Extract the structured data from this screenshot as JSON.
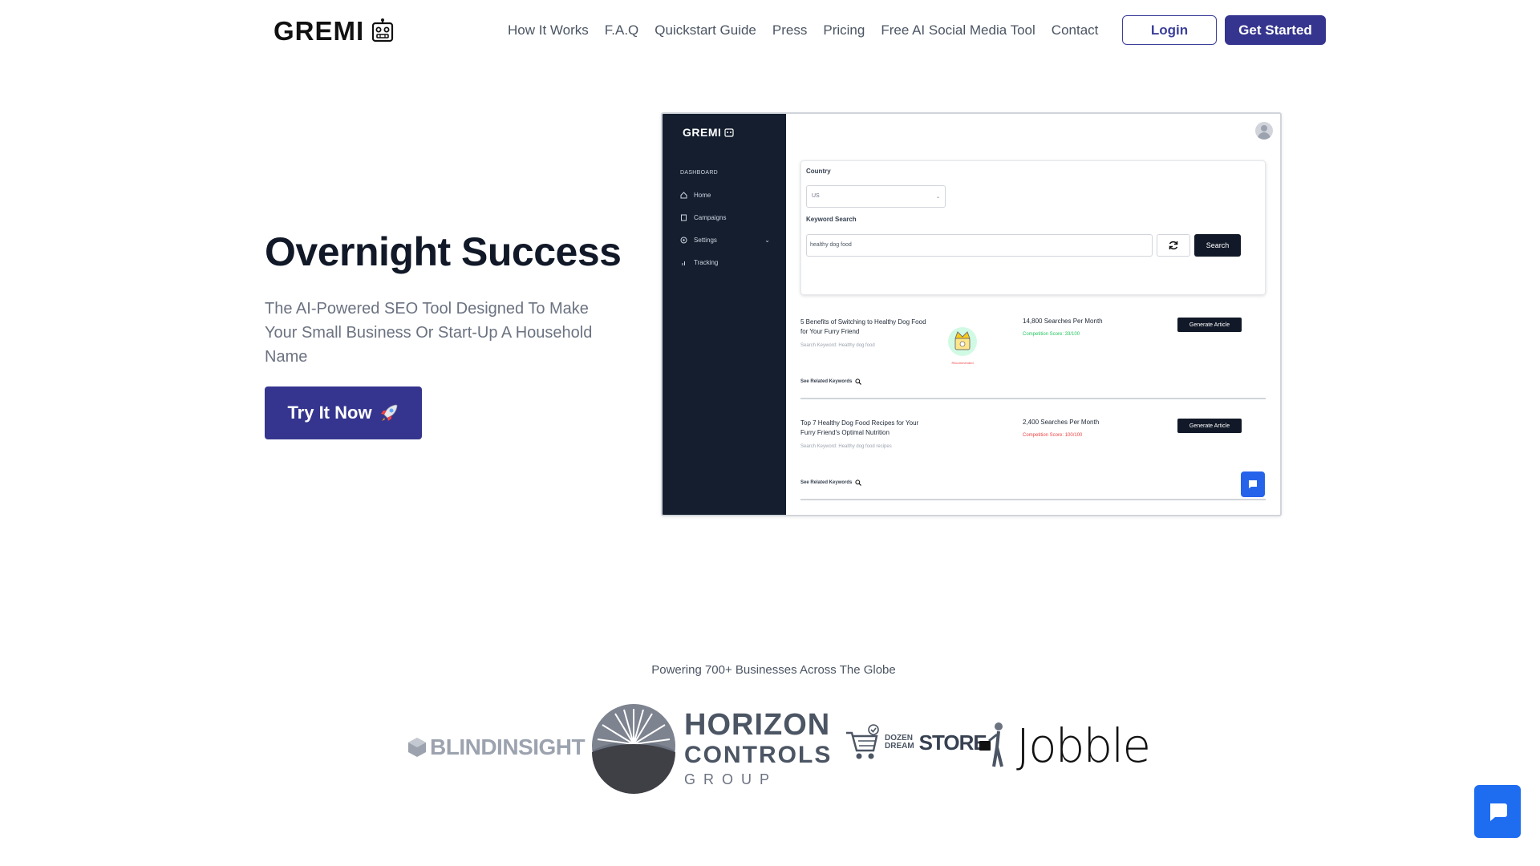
{
  "header": {
    "logo_text": "GREMI",
    "nav": [
      "How It Works",
      "F.A.Q",
      "Quickstart Guide",
      "Press",
      "Pricing",
      "Free AI Social Media Tool",
      "Contact"
    ],
    "login_label": "Login",
    "get_started_label": "Get Started"
  },
  "hero": {
    "title": "Overnight Success",
    "subtitle": "The AI-Powered SEO Tool Designed To Make Your Small Business Or Start-Up A Household Name",
    "cta_label": "Try It Now"
  },
  "mockup": {
    "logo_text": "GREMI",
    "section_label": "DASHBOARD",
    "nav": [
      "Home",
      "Campaigns",
      "Settings",
      "Tracking"
    ],
    "country_label": "Country",
    "country_value": "US",
    "keyword_label": "Keyword Search",
    "keyword_value": "healthy dog food",
    "search_label": "Search",
    "results": [
      {
        "title": "5 Benefits of Switching to Healthy Dog Food for Your Furry Friend",
        "keyword": "Search Keyword: Healthy dog food",
        "searches": "14,800 Searches Per Month",
        "competition": "Competition Score: 33/100",
        "competition_color": "#22c55e",
        "generate_label": "Generate Article",
        "related_label": "See Related Keywords",
        "badge_label": "Recommended"
      },
      {
        "title": "Top 7 Healthy Dog Food Recipes for Your Furry Friend's Optimal Nutrition",
        "keyword": "Search Keyword: Healthy dog food recipes",
        "searches": "2,400 Searches Per Month",
        "competition": "Competition Score: 100/100",
        "competition_color": "#ef4444",
        "generate_label": "Generate Article",
        "related_label": "See Related Keywords"
      }
    ]
  },
  "trust": {
    "text": "Powering 700+ Businesses Across The Globe",
    "logos": {
      "blind": "BLINDINSIGHT",
      "horizon_1": "HORIZON",
      "horizon_2": "CONTROLS",
      "horizon_3": "GROUP",
      "dozen_1": "DOZEN",
      "dozen_2": "DREAM",
      "dozen_3": "STORE",
      "jobble": "Jobble"
    }
  },
  "colors": {
    "primary": "#35358f",
    "sidebar": "#141e2e",
    "chat": "#1e6cf0"
  },
  "icons": [
    "robot-icon",
    "rocket-icon",
    "home-icon",
    "campaign-icon",
    "gear-icon",
    "chart-icon",
    "refresh-icon",
    "search-icon",
    "chat-icon",
    "user-icon"
  ]
}
